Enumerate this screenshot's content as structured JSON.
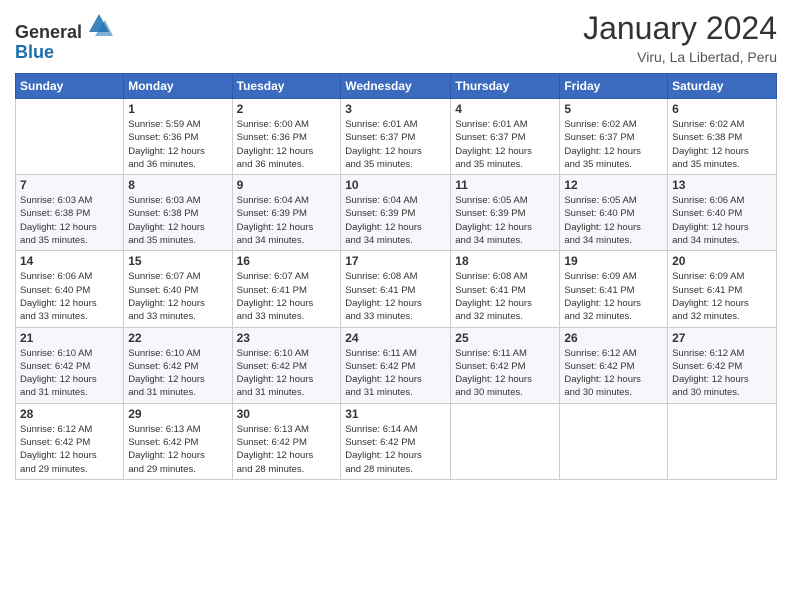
{
  "logo": {
    "general": "General",
    "blue": "Blue"
  },
  "header": {
    "title": "January 2024",
    "subtitle": "Viru, La Libertad, Peru"
  },
  "weekdays": [
    "Sunday",
    "Monday",
    "Tuesday",
    "Wednesday",
    "Thursday",
    "Friday",
    "Saturday"
  ],
  "weeks": [
    [
      {
        "day": "",
        "info": ""
      },
      {
        "day": "1",
        "info": "Sunrise: 5:59 AM\nSunset: 6:36 PM\nDaylight: 12 hours\nand 36 minutes."
      },
      {
        "day": "2",
        "info": "Sunrise: 6:00 AM\nSunset: 6:36 PM\nDaylight: 12 hours\nand 36 minutes."
      },
      {
        "day": "3",
        "info": "Sunrise: 6:01 AM\nSunset: 6:37 PM\nDaylight: 12 hours\nand 35 minutes."
      },
      {
        "day": "4",
        "info": "Sunrise: 6:01 AM\nSunset: 6:37 PM\nDaylight: 12 hours\nand 35 minutes."
      },
      {
        "day": "5",
        "info": "Sunrise: 6:02 AM\nSunset: 6:37 PM\nDaylight: 12 hours\nand 35 minutes."
      },
      {
        "day": "6",
        "info": "Sunrise: 6:02 AM\nSunset: 6:38 PM\nDaylight: 12 hours\nand 35 minutes."
      }
    ],
    [
      {
        "day": "7",
        "info": "Sunrise: 6:03 AM\nSunset: 6:38 PM\nDaylight: 12 hours\nand 35 minutes."
      },
      {
        "day": "8",
        "info": "Sunrise: 6:03 AM\nSunset: 6:38 PM\nDaylight: 12 hours\nand 35 minutes."
      },
      {
        "day": "9",
        "info": "Sunrise: 6:04 AM\nSunset: 6:39 PM\nDaylight: 12 hours\nand 34 minutes."
      },
      {
        "day": "10",
        "info": "Sunrise: 6:04 AM\nSunset: 6:39 PM\nDaylight: 12 hours\nand 34 minutes."
      },
      {
        "day": "11",
        "info": "Sunrise: 6:05 AM\nSunset: 6:39 PM\nDaylight: 12 hours\nand 34 minutes."
      },
      {
        "day": "12",
        "info": "Sunrise: 6:05 AM\nSunset: 6:40 PM\nDaylight: 12 hours\nand 34 minutes."
      },
      {
        "day": "13",
        "info": "Sunrise: 6:06 AM\nSunset: 6:40 PM\nDaylight: 12 hours\nand 34 minutes."
      }
    ],
    [
      {
        "day": "14",
        "info": "Sunrise: 6:06 AM\nSunset: 6:40 PM\nDaylight: 12 hours\nand 33 minutes."
      },
      {
        "day": "15",
        "info": "Sunrise: 6:07 AM\nSunset: 6:40 PM\nDaylight: 12 hours\nand 33 minutes."
      },
      {
        "day": "16",
        "info": "Sunrise: 6:07 AM\nSunset: 6:41 PM\nDaylight: 12 hours\nand 33 minutes."
      },
      {
        "day": "17",
        "info": "Sunrise: 6:08 AM\nSunset: 6:41 PM\nDaylight: 12 hours\nand 33 minutes."
      },
      {
        "day": "18",
        "info": "Sunrise: 6:08 AM\nSunset: 6:41 PM\nDaylight: 12 hours\nand 32 minutes."
      },
      {
        "day": "19",
        "info": "Sunrise: 6:09 AM\nSunset: 6:41 PM\nDaylight: 12 hours\nand 32 minutes."
      },
      {
        "day": "20",
        "info": "Sunrise: 6:09 AM\nSunset: 6:41 PM\nDaylight: 12 hours\nand 32 minutes."
      }
    ],
    [
      {
        "day": "21",
        "info": "Sunrise: 6:10 AM\nSunset: 6:42 PM\nDaylight: 12 hours\nand 31 minutes."
      },
      {
        "day": "22",
        "info": "Sunrise: 6:10 AM\nSunset: 6:42 PM\nDaylight: 12 hours\nand 31 minutes."
      },
      {
        "day": "23",
        "info": "Sunrise: 6:10 AM\nSunset: 6:42 PM\nDaylight: 12 hours\nand 31 minutes."
      },
      {
        "day": "24",
        "info": "Sunrise: 6:11 AM\nSunset: 6:42 PM\nDaylight: 12 hours\nand 31 minutes."
      },
      {
        "day": "25",
        "info": "Sunrise: 6:11 AM\nSunset: 6:42 PM\nDaylight: 12 hours\nand 30 minutes."
      },
      {
        "day": "26",
        "info": "Sunrise: 6:12 AM\nSunset: 6:42 PM\nDaylight: 12 hours\nand 30 minutes."
      },
      {
        "day": "27",
        "info": "Sunrise: 6:12 AM\nSunset: 6:42 PM\nDaylight: 12 hours\nand 30 minutes."
      }
    ],
    [
      {
        "day": "28",
        "info": "Sunrise: 6:12 AM\nSunset: 6:42 PM\nDaylight: 12 hours\nand 29 minutes."
      },
      {
        "day": "29",
        "info": "Sunrise: 6:13 AM\nSunset: 6:42 PM\nDaylight: 12 hours\nand 29 minutes."
      },
      {
        "day": "30",
        "info": "Sunrise: 6:13 AM\nSunset: 6:42 PM\nDaylight: 12 hours\nand 28 minutes."
      },
      {
        "day": "31",
        "info": "Sunrise: 6:14 AM\nSunset: 6:42 PM\nDaylight: 12 hours\nand 28 minutes."
      },
      {
        "day": "",
        "info": ""
      },
      {
        "day": "",
        "info": ""
      },
      {
        "day": "",
        "info": ""
      }
    ]
  ]
}
